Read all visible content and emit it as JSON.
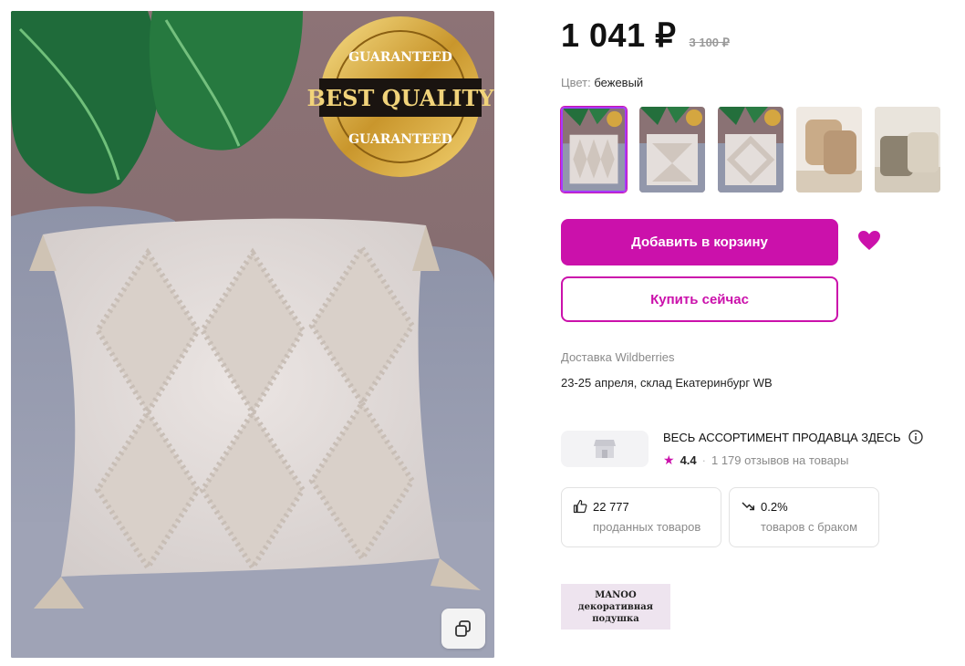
{
  "product": {
    "price": "1 041 ₽",
    "old_price": "3 100 ₽",
    "badge_top": "GUARANTEED",
    "badge_mid": "BEST QUALITY",
    "badge_bottom": "GUARANTEED"
  },
  "color": {
    "label": "Цвет:",
    "value": "бежевый"
  },
  "thumbnails": [
    {
      "name": "variant-1",
      "active": true
    },
    {
      "name": "variant-2",
      "active": false
    },
    {
      "name": "variant-3",
      "active": false
    },
    {
      "name": "variant-4",
      "active": false
    },
    {
      "name": "variant-5",
      "active": false
    }
  ],
  "actions": {
    "add_to_cart": "Добавить в корзину",
    "buy_now": "Купить сейчас"
  },
  "delivery": {
    "title": "Доставка Wildberries",
    "info": "23-25 апреля, склад Екатеринбург WB"
  },
  "seller": {
    "title": "ВЕСЬ АССОРТИМЕНТ ПРОДАВЦА ЗДЕСЬ",
    "rating": "4.4",
    "reviews": "1 179 отзывов на товары"
  },
  "stats": {
    "sold_count": "22 777",
    "sold_label": "проданных товаров",
    "defect_rate": "0.2%",
    "defect_label": "товаров с браком"
  },
  "brand": {
    "line1": "MANOO",
    "line2": "декоративная",
    "line3": "подушка"
  },
  "colors": {
    "accent": "#cb11ab",
    "accent_border": "#a73afd",
    "muted_text": "#8a8a8a"
  },
  "icons": [
    "copy-icon",
    "heart-icon",
    "shop-icon",
    "info-icon",
    "star-icon",
    "thumbs-up-icon",
    "trend-down-icon"
  ]
}
